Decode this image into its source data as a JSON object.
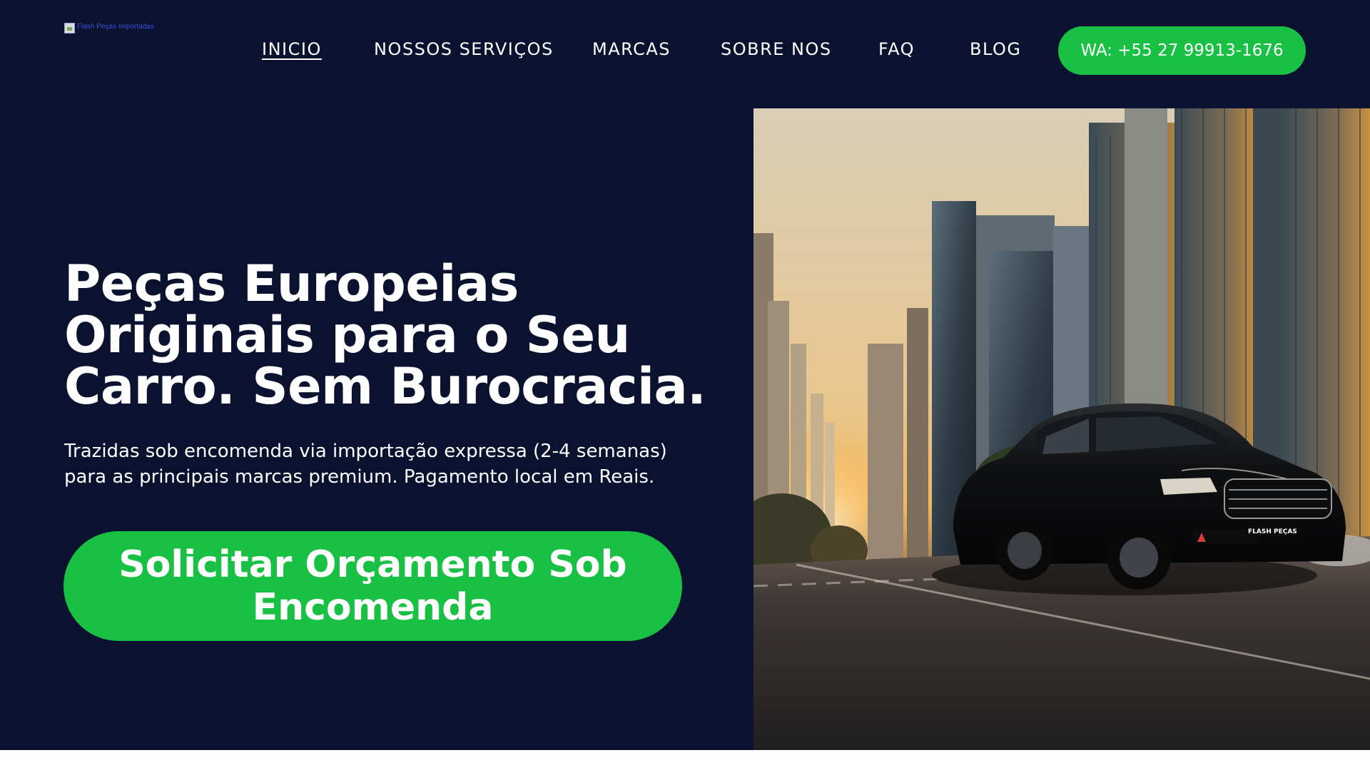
{
  "header": {
    "logo_alt": "Flash Peças Importadas",
    "nav": [
      {
        "label": "INICIO",
        "active": true
      },
      {
        "label": "NOSSOS SERVIÇOS",
        "active": false
      },
      {
        "label": "MARCAS",
        "active": false
      },
      {
        "label": "SOBRE NOS",
        "active": false
      },
      {
        "label": "FAQ",
        "active": false
      },
      {
        "label": "BLOG",
        "active": false
      }
    ],
    "whatsapp_label": "WA: +55 27 99913-1676"
  },
  "hero": {
    "title": "Peças Europeias Originais para o Seu Carro. Sem Burocracia.",
    "subtitle": "Trazidas sob encomenda via importação expressa (2-4 semanas) para as principais marcas premium. Pagamento local em Reais.",
    "cta_label": "Solicitar Orçamento Sob Encomenda",
    "image": {
      "plate_text": "FLASH PEÇAS"
    }
  },
  "colors": {
    "background": "#0a1230",
    "accent": "#18c044",
    "text": "#ffffff"
  }
}
